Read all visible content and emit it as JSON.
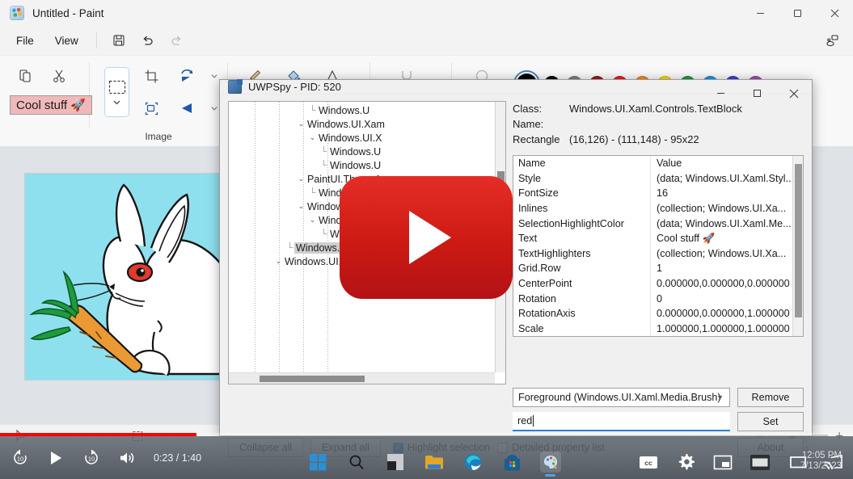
{
  "paint": {
    "title": "Untitled - Paint",
    "app_icon": "paint-palette-icon",
    "window_buttons": {
      "minimize": "–",
      "maximize": "❐",
      "close": "✕"
    },
    "menu": [
      {
        "label": "File"
      },
      {
        "label": "View"
      }
    ],
    "menu_icons": [
      {
        "name": "save-icon"
      },
      {
        "name": "undo-icon"
      },
      {
        "name": "redo-icon"
      }
    ],
    "share_icon": "share-icon",
    "ribbon": {
      "clipboard": {
        "label": "",
        "paste_icon": "paste-icon",
        "cut_icon": "cut-icon",
        "copy_icon": "copy-icon"
      },
      "image": {
        "label": "Image"
      },
      "selection_label": "Cool stuff 🚀",
      "tools": [
        "pencil-icon",
        "fill-icon",
        "text-icon",
        "eraser-icon",
        "brush-icon"
      ],
      "colors": [
        {
          "name": "current-color",
          "hex": "#000000",
          "active": true
        },
        {
          "name": "black",
          "hex": "#000000"
        },
        {
          "name": "gray",
          "hex": "#7f7f7f"
        },
        {
          "name": "dark-red",
          "hex": "#9b1b1b"
        },
        {
          "name": "red",
          "hex": "#ed1c24"
        },
        {
          "name": "orange",
          "hex": "#f28a21"
        },
        {
          "name": "yellow",
          "hex": "#f5d908"
        },
        {
          "name": "green",
          "hex": "#1d9b3e"
        },
        {
          "name": "light-blue",
          "hex": "#1896e8"
        },
        {
          "name": "blue",
          "hex": "#3c3fd4"
        },
        {
          "name": "purple",
          "hex": "#a44bb0"
        }
      ]
    },
    "canvas": {
      "background_hex": "#8fe0ef",
      "description": "white rabbit eating an orange carrot"
    },
    "statusbar": {
      "cursor_icon": "cursor-icon",
      "selection_icon": "selection-size-icon",
      "zoom_out": "–",
      "zoom_in": "+"
    }
  },
  "uwpspy": {
    "title": "UWPSpy - PID: 520",
    "icon": "uwpspy-icon",
    "window_buttons": {
      "minimize": "–",
      "maximize": "❐",
      "close": "✕"
    },
    "tree": [
      {
        "indent": 7,
        "marker": "elbow",
        "label": "Windows.U"
      },
      {
        "indent": 6,
        "marker": "chevron",
        "label": "Windows.UI.Xam"
      },
      {
        "indent": 7,
        "marker": "chevron",
        "label": "Windows.UI.X"
      },
      {
        "indent": 8,
        "marker": "elbow",
        "label": "Windows.U"
      },
      {
        "indent": 8,
        "marker": "elbow",
        "label": "Windows.U"
      },
      {
        "indent": 6,
        "marker": "chevron",
        "label": "PaintUI.ThemeAwar"
      },
      {
        "indent": 7,
        "marker": "elbow",
        "label": "Windows.UI.Xam"
      },
      {
        "indent": 6,
        "marker": "chevron",
        "label": "Windows.UI.Xaml.C"
      },
      {
        "indent": 7,
        "marker": "chevron",
        "label": "Windows.UI.Xam"
      },
      {
        "indent": 8,
        "marker": "elbow",
        "label": "Windows.UI.X"
      },
      {
        "indent": 5,
        "marker": "elbow",
        "label": "Windows.UI.Xaml.Controls.TextBlock",
        "selected": true
      },
      {
        "indent": 4,
        "marker": "chevron",
        "label": "Windows.UI.Xaml.Controls.Border"
      }
    ],
    "details": {
      "class_key": "Class:",
      "class_value": "Windows.UI.Xaml.Controls.TextBlock",
      "name_key": "Name:",
      "name_value": "",
      "rect_key": "Rectangle",
      "rect_value": "(16,126) - (111,148)  -  95x22"
    },
    "properties": {
      "headers": [
        "Name",
        "Value"
      ],
      "rows": [
        {
          "name": "Style",
          "value": "(data; Windows.UI.Xaml.Styl..."
        },
        {
          "name": "FontSize",
          "value": "16"
        },
        {
          "name": "Inlines",
          "value": "(collection; Windows.UI.Xa..."
        },
        {
          "name": "SelectionHighlightColor",
          "value": "(data; Windows.UI.Xaml.Me..."
        },
        {
          "name": "Text",
          "value": "Cool stuff 🚀"
        },
        {
          "name": "TextHighlighters",
          "value": "(collection; Windows.UI.Xa..."
        },
        {
          "name": "Grid.Row",
          "value": "1"
        },
        {
          "name": "CenterPoint",
          "value": "0.000000,0.000000,0.000000"
        },
        {
          "name": "Rotation",
          "value": "0"
        },
        {
          "name": "RotationAxis",
          "value": "0.000000,0.000000,1.000000"
        },
        {
          "name": "Scale",
          "value": "1.000000,1.000000,1.000000"
        }
      ]
    },
    "editor": {
      "property_select": "Foreground (Windows.UI.Xaml.Media.Brush)",
      "value_input": "red",
      "value_placeholder": "",
      "remove_button": "Remove",
      "set_button": "Set"
    },
    "bottom": {
      "collapse_all": "Collapse all",
      "expand_all": "Expand all",
      "highlight_selection": "Highlight selection",
      "highlight_selection_checked": true,
      "detailed_property_list": "Detailed property list",
      "detailed_property_list_checked": false,
      "about": "About"
    }
  },
  "video": {
    "play_button": "play-button-overlay",
    "controls": {
      "rewind_10": "replay-10-icon",
      "play": "play-icon",
      "forward_10": "forward-10-icon",
      "volume": "volume-icon",
      "time": "0:23 / 1:40",
      "captions": "cc-icon",
      "settings": "settings-gear-icon",
      "miniplayer": "miniplayer-icon",
      "theater": "theater-mode-icon",
      "cast": "cast-icon"
    },
    "progress_percent": 23
  },
  "taskbar": {
    "items": [
      {
        "name": "start-icon"
      },
      {
        "name": "search-icon"
      },
      {
        "name": "task-view-icon"
      },
      {
        "name": "file-explorer-icon"
      },
      {
        "name": "edge-icon"
      },
      {
        "name": "microsoft-store-icon"
      },
      {
        "name": "paint-icon",
        "active": true
      }
    ],
    "clock_time": "12:05 PM",
    "clock_date": "7/13/2023"
  }
}
